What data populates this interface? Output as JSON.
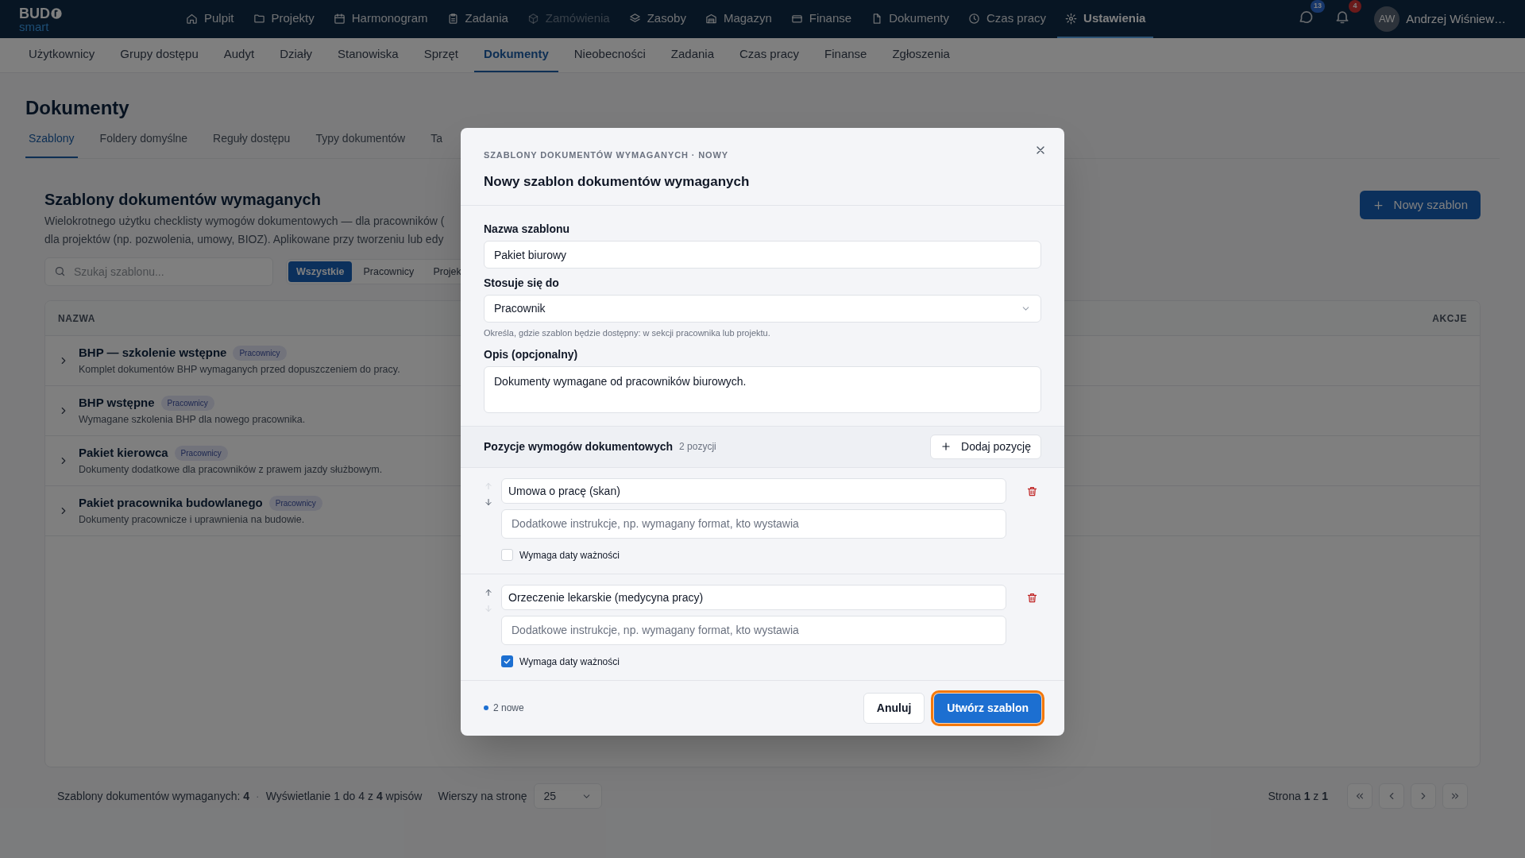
{
  "top_nav": {
    "logo": {
      "word": "BUD",
      "sub": "smart"
    },
    "items": [
      {
        "label": "Pulpit",
        "selected": false,
        "disabled": false
      },
      {
        "label": "Projekty",
        "selected": false,
        "disabled": false
      },
      {
        "label": "Harmonogram",
        "selected": false,
        "disabled": false
      },
      {
        "label": "Zadania",
        "selected": false,
        "disabled": false
      },
      {
        "label": "Zamówienia",
        "selected": false,
        "disabled": true
      },
      {
        "label": "Zasoby",
        "selected": false,
        "disabled": false
      },
      {
        "label": "Magazyn",
        "selected": false,
        "disabled": false
      },
      {
        "label": "Finanse",
        "selected": false,
        "disabled": false
      },
      {
        "label": "Dokumenty",
        "selected": false,
        "disabled": false
      },
      {
        "label": "Czas pracy",
        "selected": false,
        "disabled": false
      },
      {
        "label": "Ustawienia",
        "selected": true,
        "disabled": false
      }
    ],
    "messages_badge": "13",
    "notifications_badge": "4",
    "user": {
      "initials": "AW",
      "name": "Andrzej Wiśniew…"
    }
  },
  "sub_nav": [
    {
      "label": "Użytkownicy",
      "selected": false
    },
    {
      "label": "Grupy dostępu",
      "selected": false
    },
    {
      "label": "Audyt",
      "selected": false
    },
    {
      "label": "Działy",
      "selected": false
    },
    {
      "label": "Stanowiska",
      "selected": false
    },
    {
      "label": "Sprzęt",
      "selected": false
    },
    {
      "label": "Dokumenty",
      "selected": true
    },
    {
      "label": "Nieobecności",
      "selected": false
    },
    {
      "label": "Zadania",
      "selected": false
    },
    {
      "label": "Czas pracy",
      "selected": false
    },
    {
      "label": "Finanse",
      "selected": false
    },
    {
      "label": "Zgłoszenia",
      "selected": false
    }
  ],
  "page_title": "Dokumenty",
  "tabs": [
    {
      "label": "Szablony",
      "selected": true
    },
    {
      "label": "Foldery domyślne",
      "selected": false
    },
    {
      "label": "Reguły dostępu",
      "selected": false
    },
    {
      "label": "Typy dokumentów",
      "selected": false
    },
    {
      "label": "Ta",
      "selected": false
    }
  ],
  "section": {
    "title": "Szablony dokumentów wymaganych",
    "description_lines": [
      "Wielokrotnego użytku checklisty wymogów dokumentowych — dla pracowników (",
      "dla projektów (np. pozwolenia, umowy, BIOZ). Aplikowane przy tworzeniu lub edy"
    ],
    "new_button": "Nowy szablon"
  },
  "search": {
    "placeholder": "Szukaj szablonu..."
  },
  "filters": [
    {
      "label": "Wszystkie",
      "selected": true
    },
    {
      "label": "Pracownicy",
      "selected": false
    },
    {
      "label": "Projek",
      "selected": false
    }
  ],
  "table": {
    "columns": [
      "NAZWA",
      "AKCJE"
    ],
    "rows": [
      {
        "name": "BHP — szkolenie wstępne",
        "tag": "Pracownicy",
        "description": "Komplet dokumentów BHP wymaganych przed dopuszczeniem do pracy."
      },
      {
        "name": "BHP wstępne",
        "tag": "Pracownicy",
        "description": "Wymagane szkolenia BHP dla nowego pracownika."
      },
      {
        "name": "Pakiet kierowca",
        "tag": "Pracownicy",
        "description": "Dokumenty dodatkowe dla pracowników z prawem jazdy służbowym."
      },
      {
        "name": "Pakiet pracownika budowlanego",
        "tag": "Pracownicy",
        "description": "Dokumenty pracownicze i uprawnienia na budowie."
      }
    ]
  },
  "footer": {
    "total": "Szablony dokumentów wymaganych: **4**",
    "separator": "·",
    "showing": "Wyświetlanie 1 do 4 z **4** wpisów",
    "rows_label": "Wierszy na stronę",
    "rows_value": "25",
    "page": "Strona **1** z **1**"
  },
  "modal": {
    "eyebrow": "SZABLONY DOKUMENTÓW WYMAGANYCH · NOWY",
    "title": "Nowy szablon dokumentów wymaganych",
    "name_label": "Nazwa szablonu",
    "name_value": "Pakiet biurowy",
    "applies_label": "Stosuje się do",
    "applies_value": "Pracownik",
    "applies_hint": "Określa, gdzie szablon będzie dostępny: w sekcji pracownika lub projektu.",
    "description_label": "Opis (opcjonalny)",
    "description_value": "Dokumenty wymagane od pracowników biurowych.",
    "items_title": "Pozycje wymogów dokumentowych",
    "items_count": "2 pozycji",
    "add_button": "Dodaj pozycję",
    "items": [
      {
        "title": "Umowa o pracę (skan)",
        "instructions_placeholder": "Dodatkowe instrukcje, np. wymagany format, kto wystawia",
        "checkbox_label": "Wymaga daty ważności",
        "checked": false,
        "move_up_disabled": true,
        "move_down_disabled": false
      },
      {
        "title": "Orzeczenie lekarskie (medycyna pracy)",
        "instructions_placeholder": "Dodatkowe instrukcje, np. wymagany format, kto wystawia",
        "checkbox_label": "Wymaga daty ważności",
        "checked": true,
        "move_up_disabled": false,
        "move_down_disabled": true
      }
    ],
    "status": "2 nowe",
    "cancel_button": "Anuluj",
    "submit_button": {
      "label": "Utwórz szablon",
      "focused": true
    }
  }
}
